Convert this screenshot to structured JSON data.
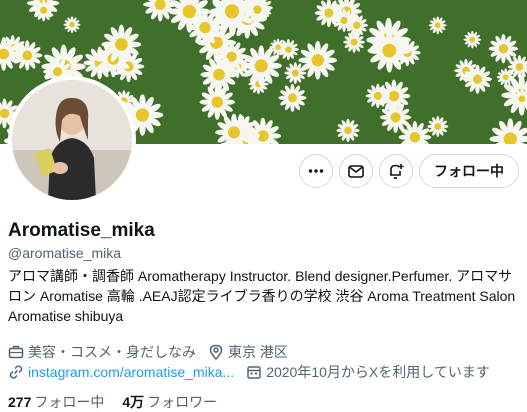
{
  "profile": {
    "display_name": "Aromatise_mika",
    "handle": "@aromatise_mika",
    "bio": "アロマ講師・調香師 Aromatherapy Instructor. Blend designer.Perfumer. アロマサロン Aromatise 高輪 .AEAJ認定ライブラ香りの学校 渋谷 Aroma Treatment Salon Aromatise shibuya",
    "category": "美容・コスメ・身だしなみ",
    "location": "東京 港区",
    "website": "instagram.com/aromatise_mika...",
    "joined": "2020年10月からXを利用しています",
    "following_count": "277",
    "following_label": "フォロー中",
    "followers_count": "4万",
    "followers_label": "フォロワー"
  },
  "actions": {
    "follow_label": "フォロー中",
    "more_icon": "more-icon",
    "message_icon": "envelope-icon",
    "notify_icon": "bell-plus-icon"
  },
  "icons": {
    "category": "briefcase-icon",
    "location": "location-pin-icon",
    "website": "link-icon",
    "joined": "calendar-icon"
  },
  "colors": {
    "accent": "#1d9bf0",
    "text_primary": "#0f1419",
    "text_secondary": "#536471",
    "border": "#cfd9de"
  }
}
